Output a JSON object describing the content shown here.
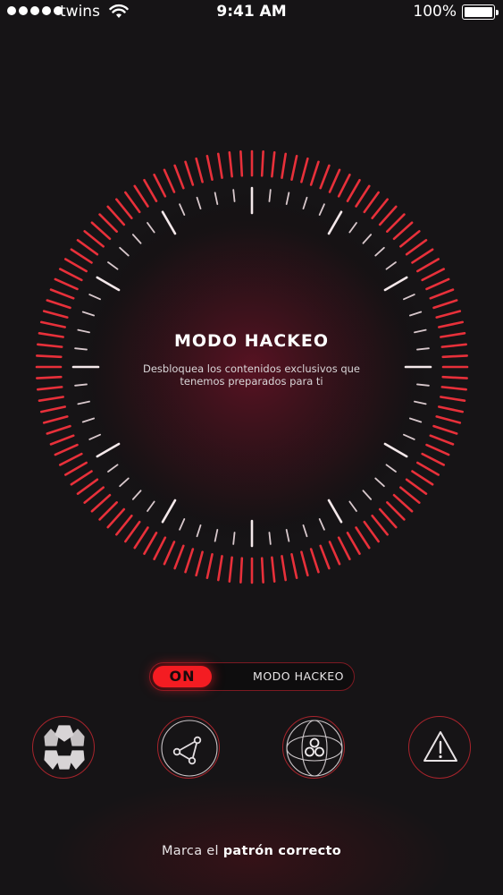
{
  "status_bar": {
    "carrier": "twins",
    "time": "9:41 AM",
    "battery": "100%"
  },
  "dial": {
    "title": "MODO HACKEO",
    "description": "Desbloquea los contenidos exclusivos que tenemos preparados para ti"
  },
  "toggle": {
    "state_label": "ON",
    "label": "MODO HACKEO"
  },
  "actions": [
    {
      "icon": "radiation-icon"
    },
    {
      "icon": "network-triangle-icon"
    },
    {
      "icon": "atom-icon"
    },
    {
      "icon": "warning-icon"
    }
  ],
  "footer": {
    "prefix": "Marca el ",
    "emphasis": "patrón correcto"
  },
  "colors": {
    "accent": "#f41c22",
    "background": "#161416"
  }
}
